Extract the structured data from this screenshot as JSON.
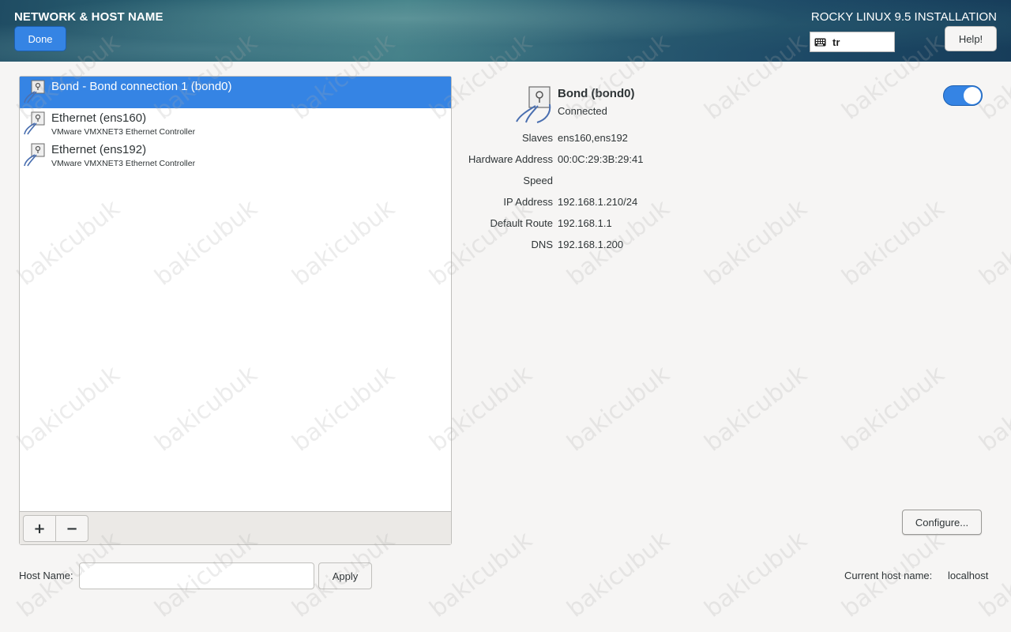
{
  "header": {
    "title": "NETWORK & HOST NAME",
    "done_label": "Done",
    "product_title": "ROCKY LINUX 9.5 INSTALLATION",
    "keyboard_layout": "tr",
    "help_label": "Help!"
  },
  "devices": [
    {
      "name": "Bond - Bond connection 1 (bond0)",
      "description": "",
      "selected": true
    },
    {
      "name": "Ethernet (ens160)",
      "description": "VMware VMXNET3 Ethernet Controller",
      "selected": false
    },
    {
      "name": "Ethernet (ens192)",
      "description": "VMware VMXNET3 Ethernet Controller",
      "selected": false
    }
  ],
  "toolbar": {
    "add_label": "+",
    "remove_label": "−"
  },
  "detail": {
    "name": "Bond (bond0)",
    "status": "Connected",
    "enabled": true,
    "properties": [
      {
        "label": "Slaves",
        "value": "ens160,ens192"
      },
      {
        "label": "Hardware Address",
        "value": "00:0C:29:3B:29:41"
      },
      {
        "label": "Speed",
        "value": ""
      },
      {
        "label": "IP Address",
        "value": "192.168.1.210/24"
      },
      {
        "label": "Default Route",
        "value": "192.168.1.1"
      },
      {
        "label": "DNS",
        "value": "192.168.1.200"
      }
    ],
    "configure_label": "Configure..."
  },
  "hostname": {
    "label": "Host Name:",
    "value": "",
    "apply_label": "Apply",
    "current_label": "Current host name:",
    "current_value": "localhost"
  },
  "watermark": "bakicubuk",
  "colors": {
    "accent": "#3584e4",
    "background": "#f6f5f4"
  }
}
